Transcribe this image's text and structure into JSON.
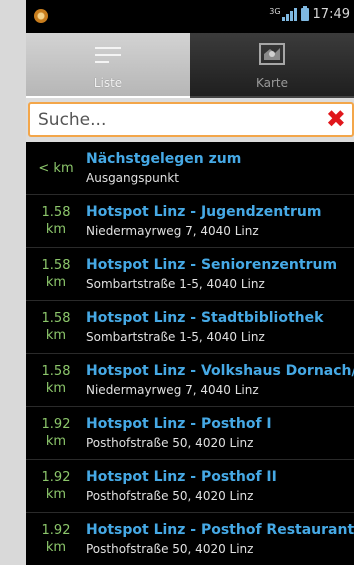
{
  "status": {
    "network": "3G",
    "time": "17:49"
  },
  "tabs": [
    {
      "label": "Liste",
      "icon": "list-icon",
      "active": true
    },
    {
      "label": "Karte",
      "icon": "map-icon",
      "active": false
    }
  ],
  "search": {
    "placeholder": "Suche...",
    "clear_icon": "close-icon"
  },
  "items": [
    {
      "dist": "< km",
      "title": "Nächstgelegen zum",
      "addr": "Ausgangspunkt"
    },
    {
      "dist": "1.58\nkm",
      "title": "Hotspot Linz - Jugendzentrum",
      "addr": "Niedermayrweg 7, 4040 Linz"
    },
    {
      "dist": "1.58\nkm",
      "title": "Hotspot Linz - Seniorenzentrum",
      "addr": "Sombartstraße 1-5, 4040 Linz"
    },
    {
      "dist": "1.58\nkm",
      "title": "Hotspot Linz - Stadtbibliothek",
      "addr": "Sombartstraße 1-5, 4040 Linz"
    },
    {
      "dist": "1.58\nkm",
      "title": "Hotspot Linz - Volkshaus Dornach/",
      "addr": "Niedermayrweg 7, 4040 Linz"
    },
    {
      "dist": "1.92\nkm",
      "title": "Hotspot Linz - Posthof I",
      "addr": "Posthofstraße 50, 4020 Linz"
    },
    {
      "dist": "1.92\nkm",
      "title": "Hotspot Linz - Posthof II",
      "addr": "Posthofstraße 50, 4020 Linz"
    },
    {
      "dist": "1.92\nkm",
      "title": "Hotspot Linz - Posthof Restaurant",
      "addr": "Posthofstraße 50, 4020 Linz"
    }
  ]
}
